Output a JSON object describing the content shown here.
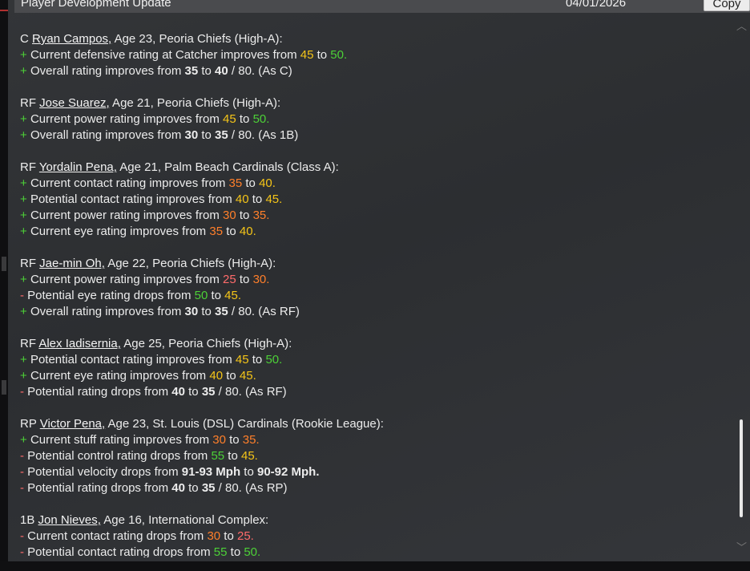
{
  "header": {
    "title": "Player Development Update",
    "date": "04/01/2026",
    "copy_label": "Copy"
  },
  "icons": {
    "scroll_up": "chevron-up-icon",
    "scroll_down": "chevron-down-icon"
  },
  "colors": {
    "plus": "#4cd137",
    "minus": "#ff6b6b",
    "rating_25": "#ff6b6b",
    "rating_30": "#ff7f2a",
    "rating_35": "#ff7f2a",
    "rating_40": "#f5c518",
    "rating_45": "#f5c518",
    "rating_50": "#4cd137",
    "rating_55": "#4cd137"
  },
  "players": [
    {
      "pos": "C",
      "name": "Ryan Campos,",
      "info": " Age 23, Peoria Chiefs (High-A):",
      "lines": [
        {
          "sign": "+",
          "kind": "plus",
          "parts": [
            [
              "t",
              "Current defensive rating at Catcher improves from "
            ],
            [
              "v45",
              "45"
            ],
            [
              "t",
              " to "
            ],
            [
              "v50",
              "50."
            ]
          ]
        },
        {
          "sign": "+",
          "kind": "plus",
          "parts": [
            [
              "t",
              "Overall rating improves from "
            ],
            [
              "b",
              "35"
            ],
            [
              "t",
              " to "
            ],
            [
              "b",
              "40"
            ],
            [
              "t",
              " / 80. (As C)"
            ]
          ]
        }
      ]
    },
    {
      "pos": "RF",
      "name": "Jose Suarez,",
      "info": " Age 21, Peoria Chiefs (High-A):",
      "lines": [
        {
          "sign": "+",
          "kind": "plus",
          "parts": [
            [
              "t",
              "Current power rating improves from "
            ],
            [
              "v45",
              "45"
            ],
            [
              "t",
              " to "
            ],
            [
              "v50",
              "50."
            ]
          ]
        },
        {
          "sign": "+",
          "kind": "plus",
          "parts": [
            [
              "t",
              "Overall rating improves from "
            ],
            [
              "b",
              "30"
            ],
            [
              "t",
              " to "
            ],
            [
              "b",
              "35"
            ],
            [
              "t",
              " / 80. (As 1B)"
            ]
          ]
        }
      ]
    },
    {
      "pos": "RF",
      "name": "Yordalin Pena,",
      "info": " Age 21, Palm Beach Cardinals (Class A):",
      "lines": [
        {
          "sign": "+",
          "kind": "plus",
          "parts": [
            [
              "t",
              "Current contact rating improves from "
            ],
            [
              "v35",
              "35"
            ],
            [
              "t",
              " to "
            ],
            [
              "v40",
              "40."
            ]
          ]
        },
        {
          "sign": "+",
          "kind": "plus",
          "parts": [
            [
              "t",
              "Potential contact rating improves from "
            ],
            [
              "v40",
              "40"
            ],
            [
              "t",
              " to "
            ],
            [
              "v45",
              "45."
            ]
          ]
        },
        {
          "sign": "+",
          "kind": "plus",
          "parts": [
            [
              "t",
              "Current power rating improves from "
            ],
            [
              "v30",
              "30"
            ],
            [
              "t",
              " to "
            ],
            [
              "v35",
              "35."
            ]
          ]
        },
        {
          "sign": "+",
          "kind": "plus",
          "parts": [
            [
              "t",
              "Current eye rating improves from "
            ],
            [
              "v35",
              "35"
            ],
            [
              "t",
              " to "
            ],
            [
              "v40",
              "40."
            ]
          ]
        }
      ]
    },
    {
      "pos": "RF",
      "name": "Jae-min Oh,",
      "info": " Age 22, Peoria Chiefs (High-A):",
      "lines": [
        {
          "sign": "+",
          "kind": "plus",
          "parts": [
            [
              "t",
              "Current power rating improves from "
            ],
            [
              "v25",
              "25"
            ],
            [
              "t",
              " to "
            ],
            [
              "v30",
              "30."
            ]
          ]
        },
        {
          "sign": "-",
          "kind": "minus",
          "parts": [
            [
              "t",
              "Potential eye rating drops from "
            ],
            [
              "v50",
              "50"
            ],
            [
              "t",
              " to "
            ],
            [
              "v45",
              "45."
            ]
          ]
        },
        {
          "sign": "+",
          "kind": "plus",
          "parts": [
            [
              "t",
              "Overall rating improves from "
            ],
            [
              "b",
              "30"
            ],
            [
              "t",
              " to "
            ],
            [
              "b",
              "35"
            ],
            [
              "t",
              " / 80. (As RF)"
            ]
          ]
        }
      ]
    },
    {
      "pos": "RF",
      "name": "Alex Iadisernia,",
      "info": " Age 25, Peoria Chiefs (High-A):",
      "lines": [
        {
          "sign": "+",
          "kind": "plus",
          "parts": [
            [
              "t",
              "Potential contact rating improves from "
            ],
            [
              "v45",
              "45"
            ],
            [
              "t",
              " to "
            ],
            [
              "v50",
              "50."
            ]
          ]
        },
        {
          "sign": "+",
          "kind": "plus",
          "parts": [
            [
              "t",
              "Current eye rating improves from "
            ],
            [
              "v40",
              "40"
            ],
            [
              "t",
              " to "
            ],
            [
              "v45",
              "45."
            ]
          ]
        },
        {
          "sign": "-",
          "kind": "minus",
          "parts": [
            [
              "t",
              "Potential rating drops from "
            ],
            [
              "b",
              "40"
            ],
            [
              "t",
              " to "
            ],
            [
              "b",
              "35"
            ],
            [
              "t",
              " / 80. (As RF)"
            ]
          ]
        }
      ]
    },
    {
      "pos": "RP",
      "name": "Victor Pena,",
      "info": " Age 23, St. Louis (DSL) Cardinals (Rookie League):",
      "lines": [
        {
          "sign": "+",
          "kind": "plus",
          "parts": [
            [
              "t",
              "Current stuff rating improves from "
            ],
            [
              "v30",
              "30"
            ],
            [
              "t",
              " to "
            ],
            [
              "v35",
              "35."
            ]
          ]
        },
        {
          "sign": "-",
          "kind": "minus",
          "parts": [
            [
              "t",
              "Potential control rating drops from "
            ],
            [
              "v55",
              "55"
            ],
            [
              "t",
              " to "
            ],
            [
              "v45",
              "45."
            ]
          ]
        },
        {
          "sign": "-",
          "kind": "minus",
          "parts": [
            [
              "t",
              "Potential velocity drops from "
            ],
            [
              "b",
              "91-93 Mph"
            ],
            [
              "t",
              " to "
            ],
            [
              "b",
              "90-92 Mph."
            ]
          ]
        },
        {
          "sign": "-",
          "kind": "minus",
          "parts": [
            [
              "t",
              "Potential rating drops from "
            ],
            [
              "b",
              "40"
            ],
            [
              "t",
              " to "
            ],
            [
              "b",
              "35"
            ],
            [
              "t",
              " / 80. (As RP)"
            ]
          ]
        }
      ]
    },
    {
      "pos": "1B",
      "name": "Jon Nieves,",
      "info": " Age 16, International Complex:",
      "lines": [
        {
          "sign": "-",
          "kind": "minus",
          "parts": [
            [
              "t",
              "Current contact rating drops from "
            ],
            [
              "v30",
              "30"
            ],
            [
              "t",
              " to "
            ],
            [
              "v25",
              "25."
            ]
          ]
        },
        {
          "sign": "-",
          "kind": "minus",
          "parts": [
            [
              "t",
              "Potential contact rating drops from "
            ],
            [
              "v55",
              "55"
            ],
            [
              "t",
              " to "
            ],
            [
              "v50",
              "50."
            ]
          ]
        }
      ]
    }
  ]
}
